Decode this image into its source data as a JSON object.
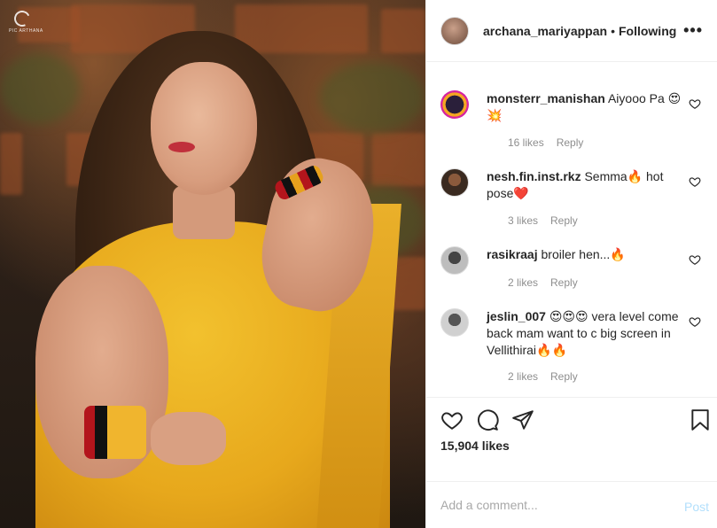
{
  "photo": {
    "watermark": "PIC ARTHANA"
  },
  "header": {
    "username": "archana_mariyappan",
    "separator": "•",
    "follow_status": "Following",
    "more_label": "•••"
  },
  "comments": [
    {
      "username": "monsterr_manishan",
      "text": "Aiyooo Pa 😍💥",
      "likes": "16 likes",
      "reply": "Reply"
    },
    {
      "username": "nesh.fin.inst.rkz",
      "text": "Semma🔥 hot pose❤️",
      "likes": "3 likes",
      "reply": "Reply"
    },
    {
      "username": "rasikraaj",
      "text": "broiler hen...🔥",
      "likes": "2 likes",
      "reply": "Reply"
    },
    {
      "username": "jeslin_007",
      "text": "😍😍😍 vera level come back mam want to c big screen in Vellithirai🔥🔥",
      "likes": "2 likes",
      "reply": "Reply"
    }
  ],
  "actions": {
    "likes_count": "15,904 likes"
  },
  "add_comment": {
    "placeholder": "Add a comment...",
    "post_label": "Post"
  },
  "icons": {
    "like": "heart-icon",
    "comment": "comment-icon",
    "share": "share-icon",
    "save": "bookmark-icon",
    "comment_like": "heart-icon",
    "more": "more-icon"
  }
}
